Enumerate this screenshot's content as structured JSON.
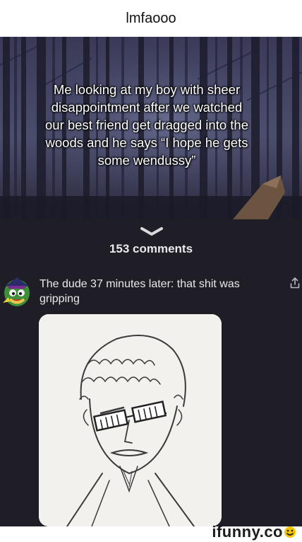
{
  "post": {
    "title": "lmfaooo",
    "meme_caption": "Me looking at my boy with sheer disappointment after we watched our best friend get dragged into the woods and he says “I hope he gets some wendussy”"
  },
  "comments": {
    "count_label": "153 comments",
    "items": [
      {
        "text": "The dude 37 minutes later: that shit was gripping",
        "avatar_icon": "cartoon-character-avatar-icon",
        "action_icon": "share-icon"
      }
    ]
  },
  "watermark": {
    "text": "ifunny.co",
    "accent_color": "#f5c400"
  },
  "colors": {
    "panel_background": "#1f1e27",
    "text_primary": "#e8e8ec"
  }
}
